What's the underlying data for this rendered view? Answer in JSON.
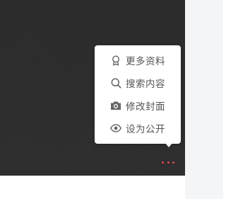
{
  "menu": {
    "items": [
      {
        "label": "更多资料",
        "icon": "badge-icon"
      },
      {
        "label": "搜索内容",
        "icon": "search-icon"
      },
      {
        "label": "修改封面",
        "icon": "camera-icon"
      },
      {
        "label": "设为公开",
        "icon": "eye-icon"
      }
    ]
  },
  "colors": {
    "cover_bg": "#2c2c2c",
    "menu_bg": "#ffffff",
    "menu_text": "#555555",
    "icon": "#666666",
    "dots_accent": "#e0464c",
    "side_strip": "#f4f5f7"
  }
}
